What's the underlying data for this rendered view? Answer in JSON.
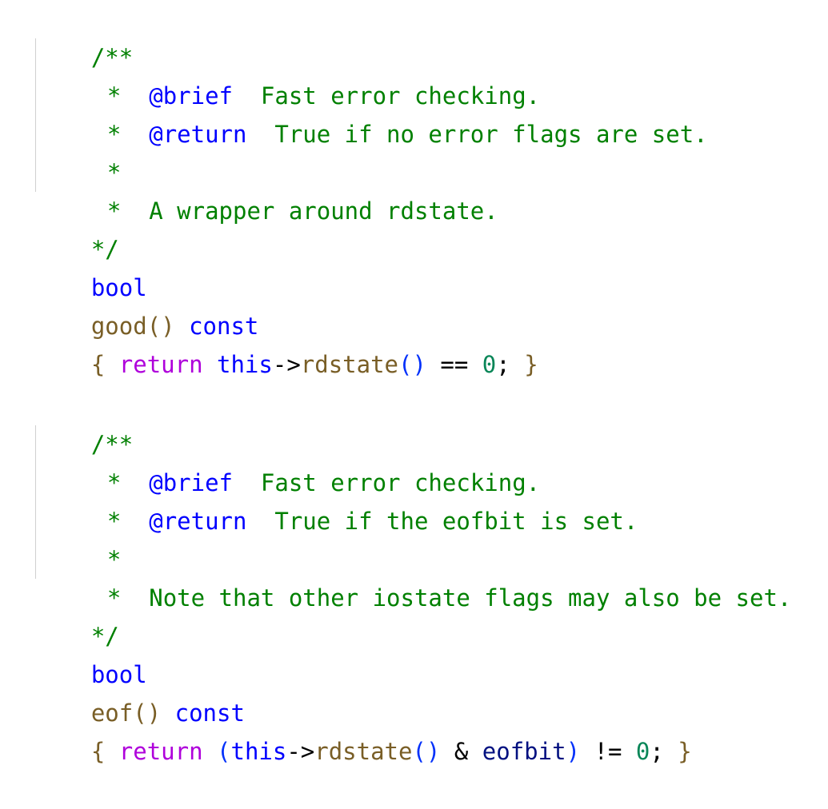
{
  "code_block_1": {
    "comment_open": "/**",
    "brief_star": "*",
    "brief_tag": "@brief",
    "brief_text": "Fast error checking.",
    "return_star": "*",
    "return_tag": "@return",
    "return_text": "True if no error flags are set.",
    "blank_star": "*",
    "note_star": "*",
    "note_text": "A wrapper around rdstate.",
    "comment_close": "*/",
    "return_type": "bool",
    "func_name": "good",
    "func_parens": "()",
    "qualifier": "const",
    "body_open": "{",
    "body_return": "return",
    "body_this": "this",
    "body_arrow": "->",
    "body_call": "rdstate",
    "body_call_parens": "()",
    "body_op": "==",
    "body_num": "0",
    "body_semi": ";",
    "body_close": "}"
  },
  "code_block_2": {
    "comment_open": "/**",
    "brief_star": "*",
    "brief_tag": "@brief",
    "brief_text": "Fast error checking.",
    "return_star": "*",
    "return_tag": "@return",
    "return_text": "True if the eofbit is set.",
    "blank_star": "*",
    "note_star": "*",
    "note_text": "Note that other iostate flags may also be set.",
    "comment_close": "*/",
    "return_type": "bool",
    "func_name": "eof",
    "func_parens": "()",
    "qualifier": "const",
    "body_open": "{",
    "body_return": "return",
    "body_lparen": "(",
    "body_this": "this",
    "body_arrow": "->",
    "body_call": "rdstate",
    "body_call_parens": "()",
    "body_amp": "&",
    "body_id": "eofbit",
    "body_rparen": ")",
    "body_op": "!=",
    "body_num": "0",
    "body_semi": ";",
    "body_close": "}"
  },
  "colors": {
    "comment": "#008000",
    "doc_tag": "#0000ff",
    "keyword_type": "#0000ff",
    "keyword_control": "#af00db",
    "function": "#795e26",
    "number": "#098658",
    "identifier": "#001080"
  }
}
